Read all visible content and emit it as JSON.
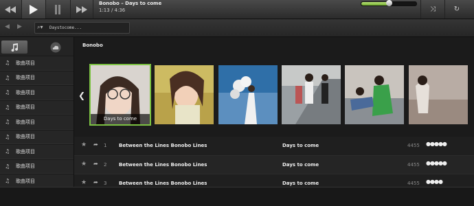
{
  "player": {
    "title": "Bonobo – Days to come",
    "time": "1:13 / 4:36",
    "volume_level": 0.5
  },
  "search": {
    "value": "Daystocome..."
  },
  "sidebar": {
    "tabs": [
      {
        "icon": "music-note-icon"
      },
      {
        "icon": "cloud-icon"
      }
    ],
    "items": [
      {
        "label": "歌曲项目"
      },
      {
        "label": "歌曲项目"
      },
      {
        "label": "歌曲项目"
      },
      {
        "label": "歌曲项目"
      },
      {
        "label": "歌曲项目"
      },
      {
        "label": "歌曲项目"
      },
      {
        "label": "歌曲项目"
      },
      {
        "label": "歌曲项目"
      },
      {
        "label": "歌曲项目"
      },
      {
        "label": "歌曲项目"
      }
    ]
  },
  "artist": {
    "name": "Bonobo",
    "albums": [
      {
        "caption": "Days to come",
        "selected": true
      },
      {
        "caption": ""
      },
      {
        "caption": ""
      },
      {
        "caption": ""
      },
      {
        "caption": ""
      },
      {
        "caption": ""
      }
    ]
  },
  "tracks": [
    {
      "number": "1",
      "name": "Between the Lines Bonobo Lines",
      "album": "Days to come",
      "count": "4455",
      "rating": 5
    },
    {
      "number": "2",
      "name": "Between the Lines Bonobo Lines",
      "album": "Days to come",
      "count": "4455",
      "rating": 5
    },
    {
      "number": "3",
      "name": "Between the Lines Bonobo Lines",
      "album": "Days to come",
      "count": "4455",
      "rating": 4
    }
  ],
  "colors": {
    "accent": "#7cc242",
    "background": "#1d1d1d"
  }
}
